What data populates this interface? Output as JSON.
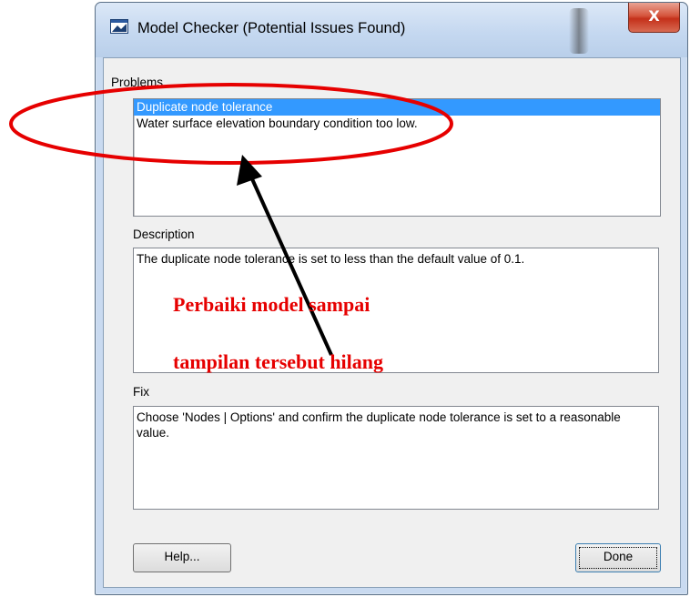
{
  "window": {
    "title": "Model Checker (Potential Issues Found)",
    "close_glyph": "X"
  },
  "problems": {
    "label": "Problems",
    "items": [
      {
        "text": "Duplicate node tolerance",
        "selected": true
      },
      {
        "text": "Water surface elevation boundary condition too low.",
        "selected": false
      }
    ]
  },
  "description": {
    "label": "Description",
    "text": "The duplicate node tolerance is set to less than the default value of 0.1."
  },
  "fix": {
    "label": "Fix",
    "text": "Choose 'Nodes | Options' and confirm the duplicate node tolerance is set to a reasonable value."
  },
  "buttons": {
    "help": "Help...",
    "done": "Done"
  },
  "annotation": {
    "line1": "Perbaiki model sampai",
    "line2": "tampilan tersebut hilang",
    "color": "#e60000"
  },
  "icons": {
    "title_icon": "app-window-icon",
    "close": "close-icon"
  }
}
